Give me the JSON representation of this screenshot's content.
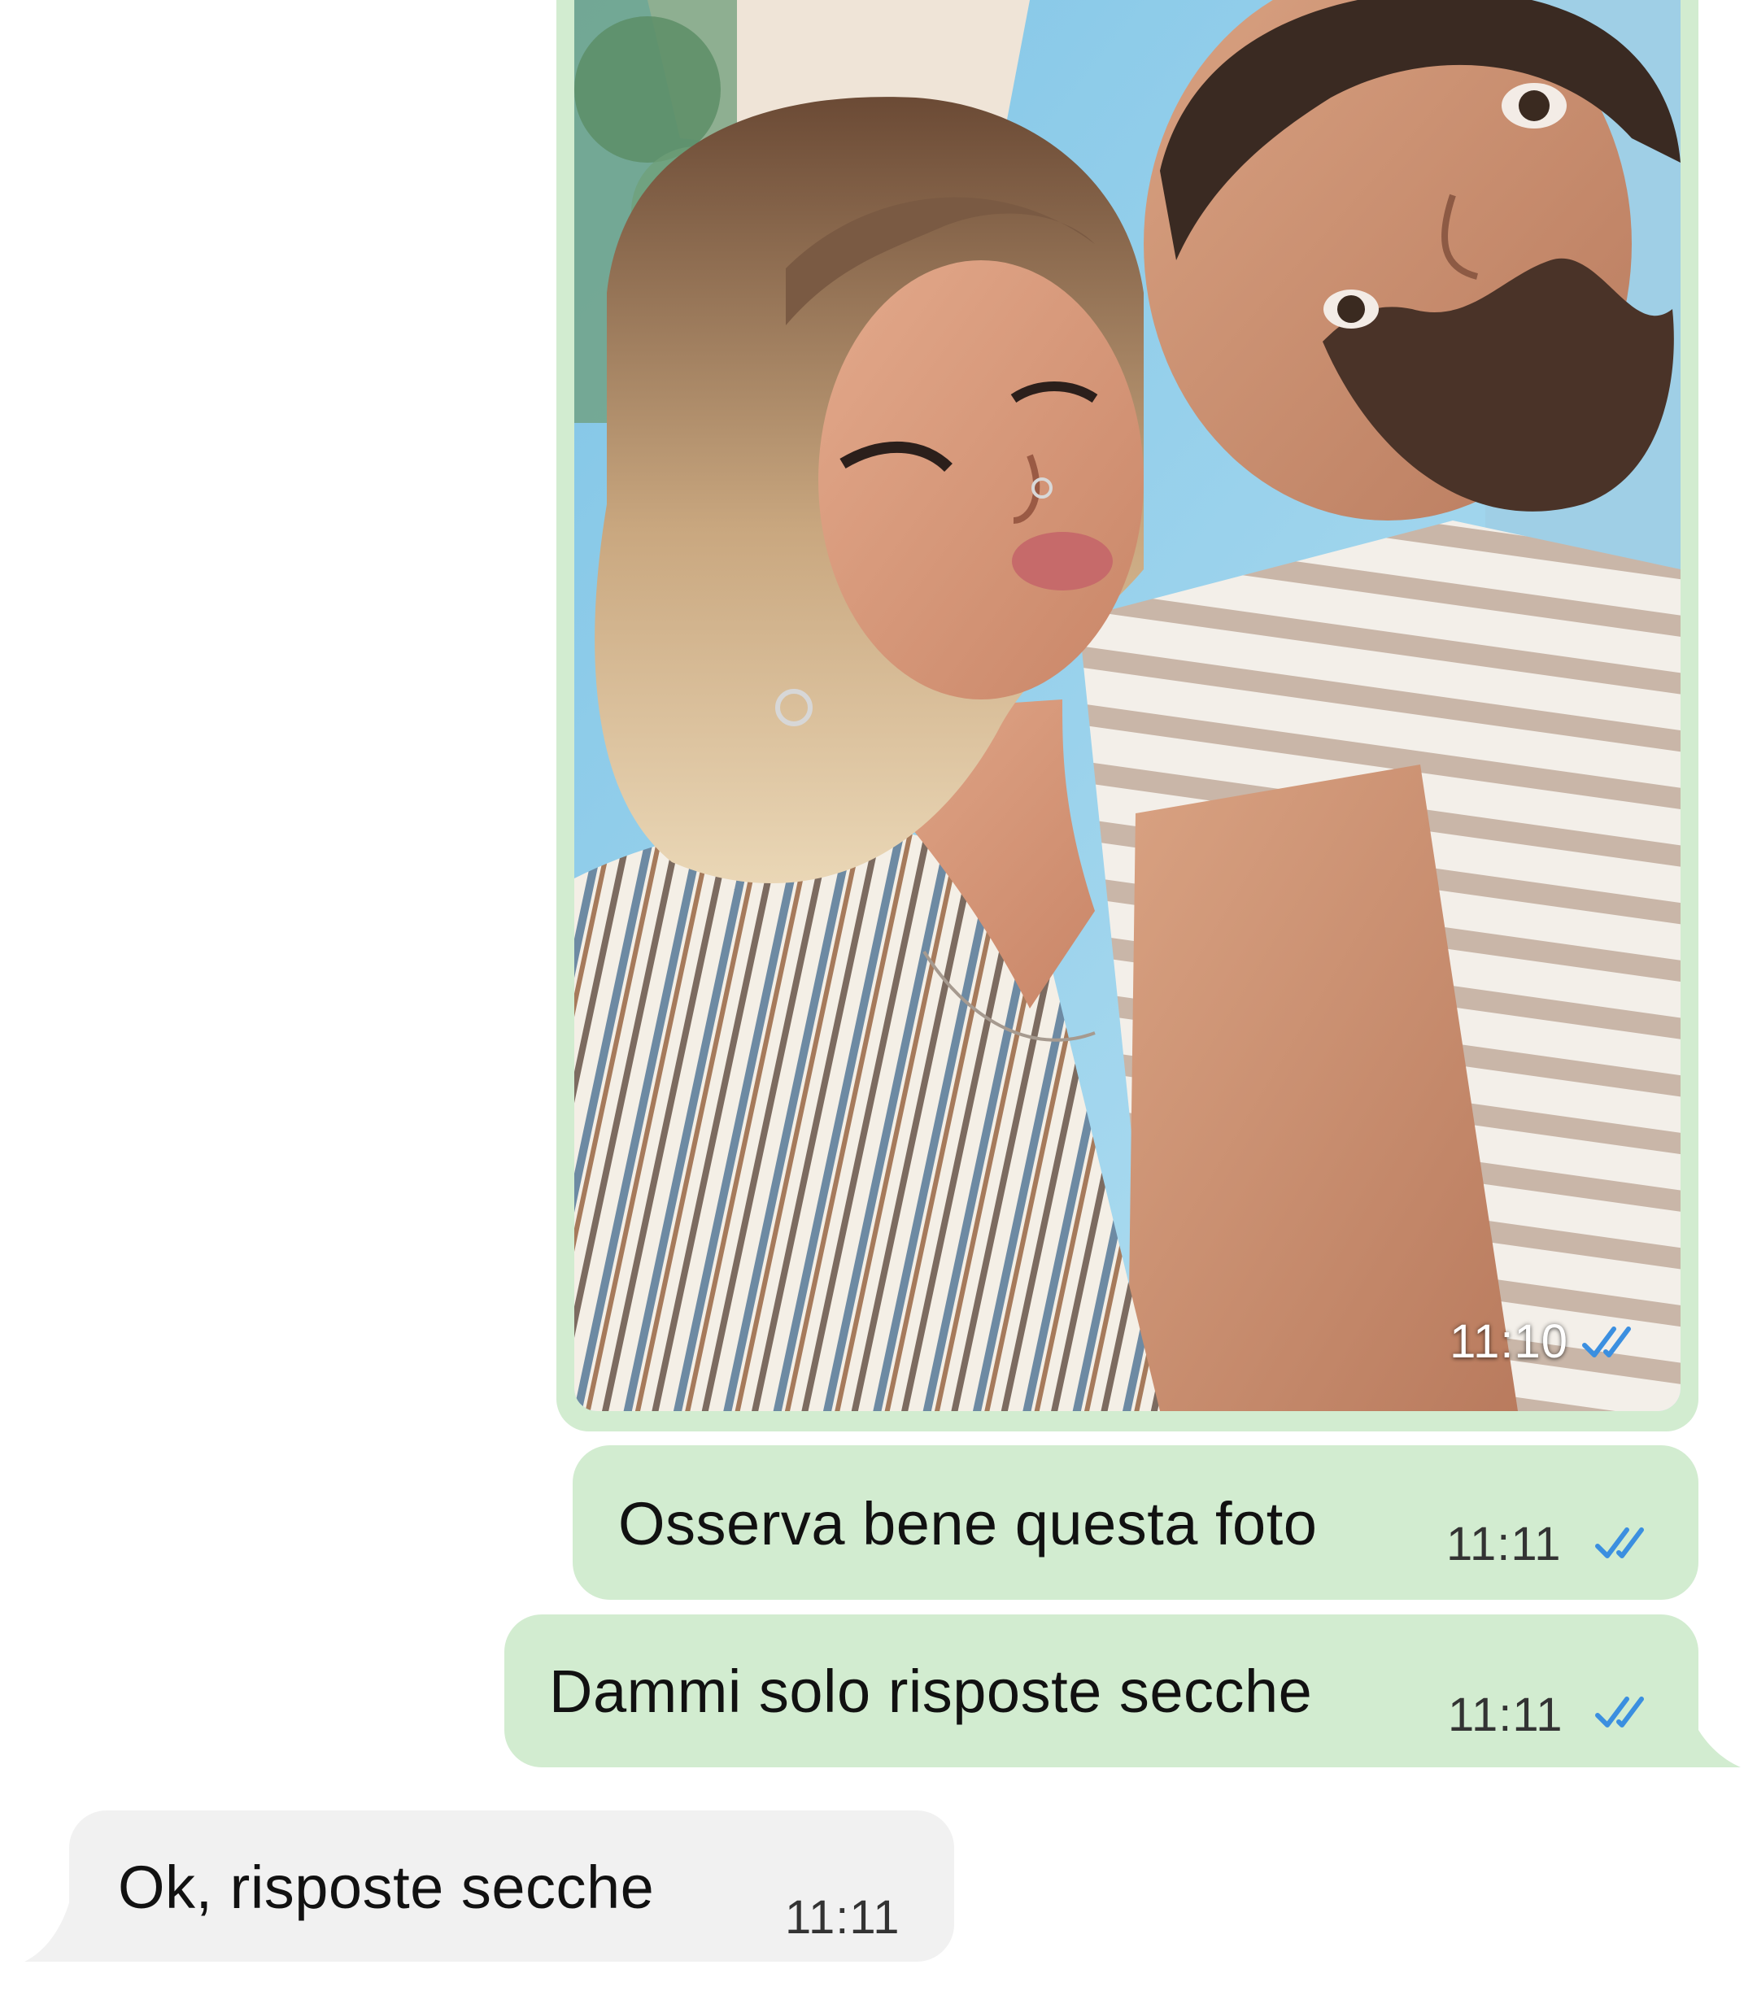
{
  "messages": {
    "photo": {
      "time": "11:10",
      "status_icon": "double-check-read-icon"
    },
    "out_1": {
      "text": "Osserva bene questa foto",
      "time": "11:11",
      "status_icon": "double-check-read-icon"
    },
    "out_2": {
      "text": "Dammi solo risposte secche",
      "time": "11:11",
      "status_icon": "double-check-read-icon"
    },
    "in_1": {
      "text": "Ok, risposte secche",
      "time": "11:11"
    }
  },
  "colors": {
    "outgoing_bubble": "#d2ecd0",
    "incoming_bubble": "#f1f1f1",
    "read_ticks": "#3b8fe0",
    "background": "#ffffff"
  }
}
